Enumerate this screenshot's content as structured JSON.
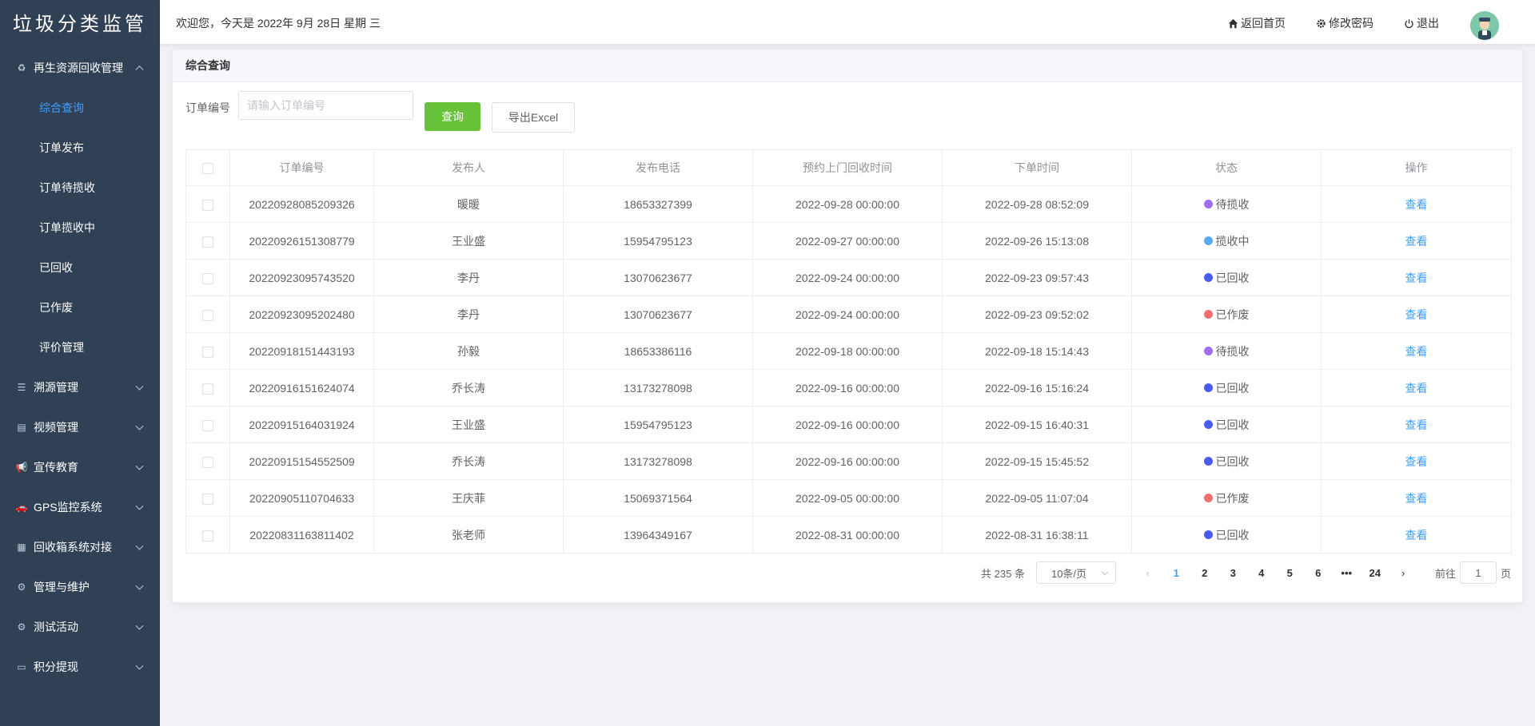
{
  "sidebar": {
    "logo": "垃圾分类监管",
    "menus": [
      {
        "label": "再生资源回收管理",
        "icon": "recycle-icon",
        "expanded": true,
        "children": [
          {
            "label": "综合查询",
            "active": true
          },
          {
            "label": "订单发布"
          },
          {
            "label": "订单待揽收"
          },
          {
            "label": "订单揽收中"
          },
          {
            "label": "已回收"
          },
          {
            "label": "已作废"
          },
          {
            "label": "评价管理",
            "has_children": true
          }
        ]
      },
      {
        "label": "溯源管理",
        "icon": "sliders-icon"
      },
      {
        "label": "视频管理",
        "icon": "document-icon"
      },
      {
        "label": "宣传教育",
        "icon": "megaphone-icon"
      },
      {
        "label": "GPS监控系统",
        "icon": "car-icon"
      },
      {
        "label": "回收箱系统对接",
        "icon": "box-icon"
      },
      {
        "label": "管理与维护",
        "icon": "gear-icon"
      },
      {
        "label": "测试活动",
        "icon": "gear-icon"
      },
      {
        "label": "积分提现",
        "icon": "card-icon"
      }
    ]
  },
  "header": {
    "welcome": "欢迎您，今天是 2022年 9月 28日 星期 三",
    "home": "返回首页",
    "change_password": "修改密码",
    "logout": "退出"
  },
  "card": {
    "title": "综合查询",
    "search": {
      "label": "订单编号",
      "placeholder": "请输入订单编号",
      "value": "",
      "query_button": "查询",
      "export_button": "导出Excel"
    }
  },
  "table": {
    "columns": [
      "订单编号",
      "发布人",
      "发布电话",
      "预约上门回收时间",
      "下单时间",
      "状态",
      "操作"
    ],
    "action_label": "查看",
    "status_colors": {
      "待揽收": "#9e6cf5",
      "揽收中": "#5aa9f0",
      "已回收": "#4a5cf0",
      "已作废": "#f07070"
    },
    "rows": [
      {
        "order_no": "20220928085209326",
        "publisher": "暖暖",
        "phone": "18653327399",
        "appointment": "2022-09-28 00:00:00",
        "order_time": "2022-09-28 08:52:09",
        "status": "待揽收"
      },
      {
        "order_no": "20220926151308779",
        "publisher": "王业盛",
        "phone": "15954795123",
        "appointment": "2022-09-27 00:00:00",
        "order_time": "2022-09-26 15:13:08",
        "status": "揽收中"
      },
      {
        "order_no": "20220923095743520",
        "publisher": "李丹",
        "phone": "13070623677",
        "appointment": "2022-09-24 00:00:00",
        "order_time": "2022-09-23 09:57:43",
        "status": "已回收"
      },
      {
        "order_no": "20220923095202480",
        "publisher": "李丹",
        "phone": "13070623677",
        "appointment": "2022-09-24 00:00:00",
        "order_time": "2022-09-23 09:52:02",
        "status": "已作废"
      },
      {
        "order_no": "20220918151443193",
        "publisher": "孙毅",
        "phone": "18653386116",
        "appointment": "2022-09-18 00:00:00",
        "order_time": "2022-09-18 15:14:43",
        "status": "待揽收"
      },
      {
        "order_no": "20220916151624074",
        "publisher": "乔长涛",
        "phone": "13173278098",
        "appointment": "2022-09-16 00:00:00",
        "order_time": "2022-09-16 15:16:24",
        "status": "已回收"
      },
      {
        "order_no": "20220915164031924",
        "publisher": "王业盛",
        "phone": "15954795123",
        "appointment": "2022-09-16 00:00:00",
        "order_time": "2022-09-15 16:40:31",
        "status": "已回收"
      },
      {
        "order_no": "20220915154552509",
        "publisher": "乔长涛",
        "phone": "13173278098",
        "appointment": "2022-09-16 00:00:00",
        "order_time": "2022-09-15 15:45:52",
        "status": "已回收"
      },
      {
        "order_no": "20220905110704633",
        "publisher": "王庆菲",
        "phone": "15069371564",
        "appointment": "2022-09-05 00:00:00",
        "order_time": "2022-09-05 11:07:04",
        "status": "已作废"
      },
      {
        "order_no": "20220831163811402",
        "publisher": "张老师",
        "phone": "13964349167",
        "appointment": "2022-08-31 00:00:00",
        "order_time": "2022-08-31 16:38:11",
        "status": "已回收"
      }
    ]
  },
  "pagination": {
    "total": "共 235 条",
    "page_size": "10条/页",
    "pages": [
      "1",
      "2",
      "3",
      "4",
      "5",
      "6",
      "•••",
      "24"
    ],
    "current": "1",
    "jump_prefix": "前往",
    "jump_value": "1",
    "jump_suffix": "页"
  }
}
